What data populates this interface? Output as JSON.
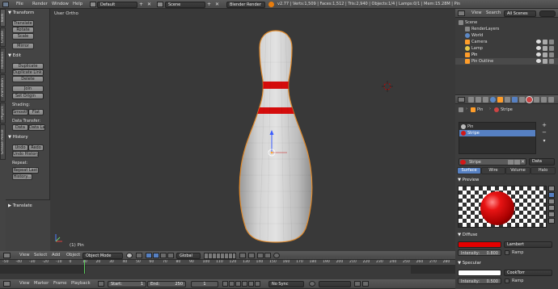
{
  "topbar": {
    "menus": [
      "File",
      "Render",
      "Window",
      "Help"
    ],
    "layout": "Default",
    "scene": "Scene",
    "engine": "Blender Render",
    "stats": "v2.77 | Verts:1,509 | Faces:1,512 | Tris:2,940 | Objects:1/4 | Lamps:0/1 | Mem:15.28M | Pin"
  },
  "toolshelf": {
    "tabs": [
      "Tools",
      "Create",
      "Relations",
      "Animation",
      "Physics",
      "Grease Pencil"
    ],
    "transform_title": "Transform",
    "transform": [
      "Translate",
      "Rotate",
      "Scale"
    ],
    "mirror": "Mirror",
    "edit_title": "Edit",
    "edit": [
      "Duplicate",
      "Duplicate Link...",
      "Delete",
      "Join"
    ],
    "set_origin": "Set Origin",
    "shading_label": "Shading:",
    "smooth": "Smooth",
    "flat": "Flat",
    "data_transfer_label": "Data Transfer:",
    "data": "Data",
    "data_la": "Data La",
    "history_title": "History",
    "undo": "Undo",
    "redo": "Redo",
    "undo_history": "Undo History",
    "repeat_label": "Repeat:",
    "repeat_last": "Repeat Last",
    "history_btn": "History...",
    "translate_title": "Translate"
  },
  "viewport": {
    "label": "User Ortho",
    "object_label": "(1) Pin"
  },
  "view3d_header": {
    "menus": [
      "View",
      "Select",
      "Add",
      "Object"
    ],
    "mode": "Object Mode",
    "orientation": "Global"
  },
  "timeline": {
    "ticks": [
      "-50",
      "-40",
      "-30",
      "-20",
      "-10",
      "0",
      "10",
      "20",
      "30",
      "40",
      "50",
      "60",
      "70",
      "80",
      "90",
      "100",
      "110",
      "120",
      "130",
      "140",
      "150",
      "160",
      "170",
      "180",
      "190",
      "200",
      "210",
      "220",
      "230",
      "240",
      "250",
      "260",
      "270",
      "280"
    ],
    "menus": [
      "View",
      "Marker",
      "Frame",
      "Playback"
    ],
    "start_label": "Start:",
    "start": "1",
    "end_label": "End:",
    "end": "250",
    "current": "1",
    "sync": "No Sync"
  },
  "outliner": {
    "menus": [
      "View",
      "Search"
    ],
    "filter": "All Scenes",
    "items": [
      "Scene",
      "RenderLayers",
      "World",
      "Camera",
      "Lamp",
      "Pin",
      "Pin Outline"
    ]
  },
  "properties": {
    "breadcrumb_obj": "Pin",
    "breadcrumb_mat": "Stripe",
    "slots": [
      "Pin",
      "Stripe"
    ],
    "material_name": "Stripe",
    "data_btn": "Data",
    "tabs": [
      "Surface",
      "Wire",
      "Volume",
      "Halo"
    ],
    "preview_title": "Preview",
    "diffuse_title": "Diffuse",
    "diffuse_shader": "Lambert",
    "intensity_label": "Intensity:",
    "diffuse_intensity": "0.800",
    "ramp": "Ramp",
    "specular_title": "Specular",
    "specular_shader": "CookTorr",
    "specular_intensity": "0.500",
    "colors": {
      "diffuse": "#e40000",
      "specular": "#ffffff"
    }
  }
}
